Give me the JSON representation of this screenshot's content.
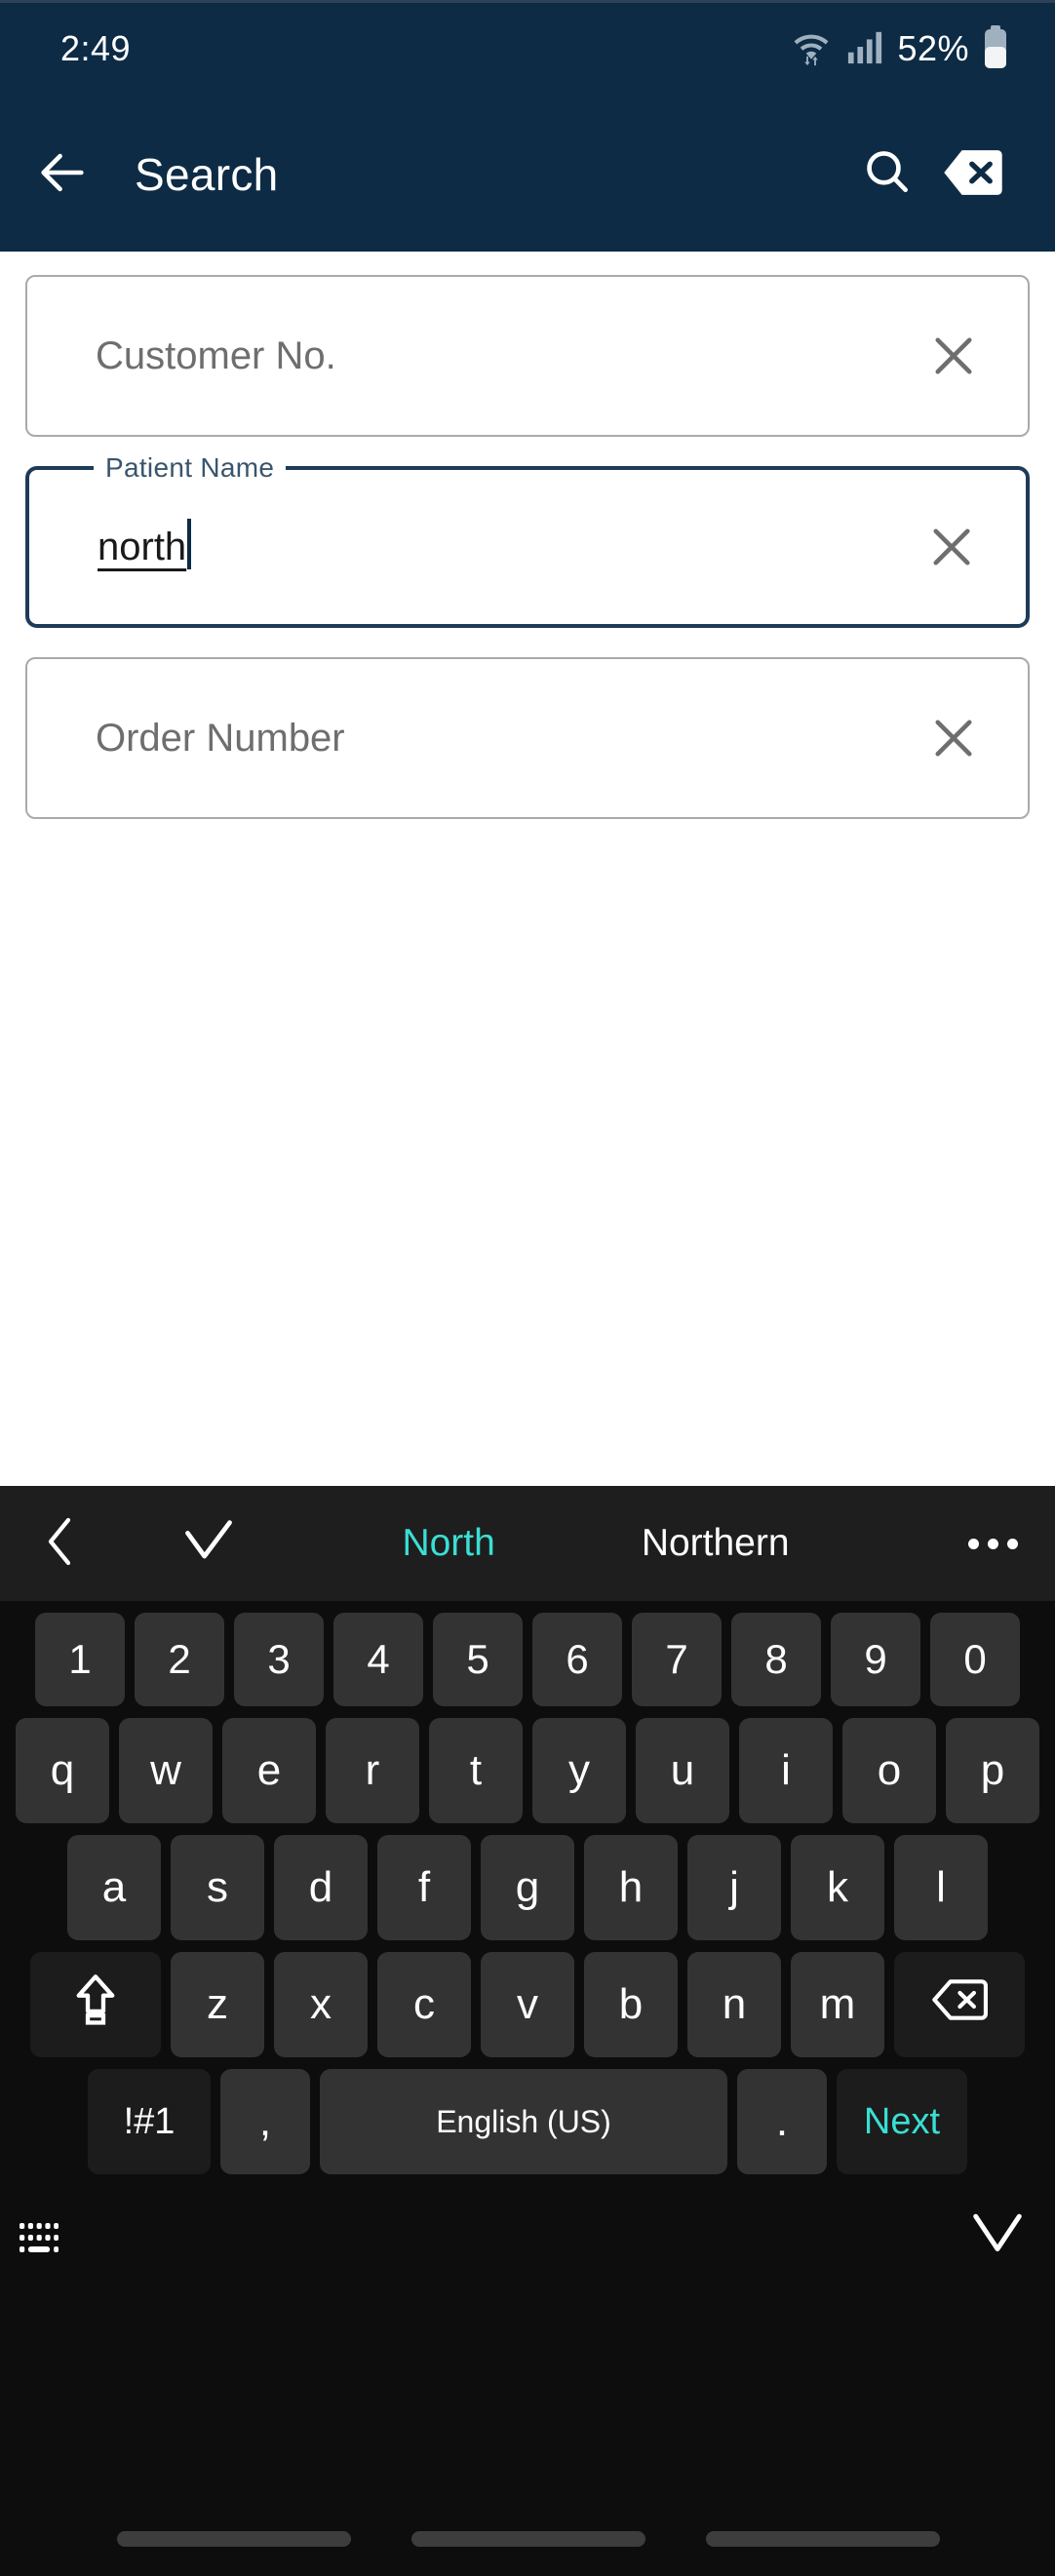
{
  "status_bar": {
    "time": "2:49",
    "battery_percent": "52%",
    "icons": [
      "wifi-icon",
      "cellular-signal-icon",
      "battery-icon"
    ]
  },
  "app_bar": {
    "back_icon": "arrow-left-icon",
    "title": "Search",
    "search_icon": "search-icon",
    "clear_all_icon": "backspace-delete-icon"
  },
  "form": {
    "fields": [
      {
        "name": "customer-no",
        "placeholder": "Customer No.",
        "value": "",
        "label": "",
        "focused": false,
        "clear_icon": "close-x-icon"
      },
      {
        "name": "patient-name",
        "placeholder": "",
        "value": "north",
        "label": "Patient Name",
        "focused": true,
        "clear_icon": "close-x-icon"
      },
      {
        "name": "order-number",
        "placeholder": "Order Number",
        "value": "",
        "label": "",
        "focused": false,
        "clear_icon": "close-x-icon"
      }
    ]
  },
  "keyboard": {
    "suggestion_bar": {
      "back_icon": "chevron-left-icon",
      "check_icon": "checkmark-icon",
      "more_icon": "overflow-dots-icon",
      "suggestions": [
        {
          "text": "North",
          "active": true
        },
        {
          "text": "Northern",
          "active": false
        }
      ]
    },
    "rows": {
      "numbers": [
        "1",
        "2",
        "3",
        "4",
        "5",
        "6",
        "7",
        "8",
        "9",
        "0"
      ],
      "top": [
        "q",
        "w",
        "e",
        "r",
        "t",
        "y",
        "u",
        "i",
        "o",
        "p"
      ],
      "home": [
        "a",
        "s",
        "d",
        "f",
        "g",
        "h",
        "j",
        "k",
        "l"
      ],
      "bottom": [
        "z",
        "x",
        "c",
        "v",
        "b",
        "n",
        "m"
      ]
    },
    "shift_icon": "shift-arrow-up-icon",
    "backspace_icon": "backspace-icon",
    "symbols_label": "!#1",
    "comma_label": ",",
    "space_label": "English (US)",
    "period_label": ".",
    "action_label": "Next",
    "footer": {
      "keyboard_switch_icon": "keyboard-icon",
      "hide_keyboard_icon": "chevron-down-icon"
    }
  },
  "colors": {
    "header_bg": "#0d2b45",
    "accent_cyan": "#39dfd4",
    "focus_border": "#1d3b57",
    "keyboard_bg": "#0d0d0d",
    "key_bg": "#333333",
    "suggestion_bg": "#1e1e1e"
  }
}
